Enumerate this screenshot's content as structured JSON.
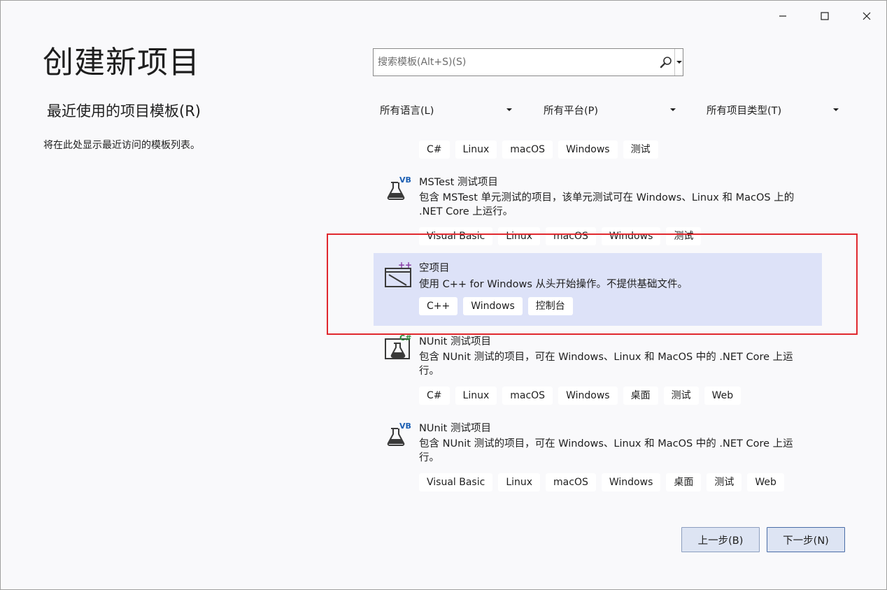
{
  "window": {
    "title": "创建新项目",
    "controls": {
      "minimize": "minimize-icon",
      "maximize": "maximize-icon",
      "close": "close-icon"
    }
  },
  "recent": {
    "heading": "最近使用的项目模板(R)",
    "empty_text": "将在此处显示最近访问的模板列表。"
  },
  "search": {
    "placeholder": "搜索模板(Alt+S)(S)",
    "value": ""
  },
  "filters": {
    "language": "所有语言(L)",
    "platform": "所有平台(P)",
    "project_type": "所有项目类型(T)"
  },
  "templates": [
    {
      "name": "",
      "description": "",
      "tags": [
        "C#",
        "Linux",
        "macOS",
        "Windows",
        "测试"
      ],
      "icon": "test-flask-icon"
    },
    {
      "name": "MSTest 测试项目",
      "description": "包含 MSTest 单元测试的项目，该单元测试可在 Windows、Linux 和 MacOS 上的 .NET Core 上运行。",
      "tags": [
        "Visual Basic",
        "Linux",
        "macOS",
        "Windows",
        "测试"
      ],
      "icon": "vb-test-flask-icon",
      "badge": "VB"
    },
    {
      "name": "空项目",
      "description": "使用 C++ for Windows 从头开始操作。不提供基础文件。",
      "tags": [
        "C++",
        "Windows",
        "控制台"
      ],
      "icon": "cpp-empty-project-icon",
      "badge": "++",
      "selected": true
    },
    {
      "name": "NUnit 测试项目",
      "description": "包含 NUnit 测试的项目，可在 Windows、Linux 和 MacOS 中的 .NET Core 上运行。",
      "tags": [
        "C#",
        "Linux",
        "macOS",
        "Windows",
        "桌面",
        "测试",
        "Web"
      ],
      "icon": "csharp-test-flask-icon",
      "badge": "C#"
    },
    {
      "name": "NUnit 测试项目",
      "description": "包含 NUnit 测试的项目，可在 Windows、Linux 和 MacOS 中的 .NET Core 上运行。",
      "tags": [
        "Visual Basic",
        "Linux",
        "macOS",
        "Windows",
        "桌面",
        "测试",
        "Web"
      ],
      "icon": "vb-test-flask-icon",
      "badge": "VB"
    }
  ],
  "buttons": {
    "back": "上一步(B)",
    "next": "下一步(N)"
  },
  "colors": {
    "background": "#f9f9fb",
    "selected_item": "#dde2f8",
    "highlight_border": "#e0282e",
    "vb_badge": "#1b5fb3",
    "cpp_badge": "#8a3fa8",
    "csharp_badge": "#2c8a3a"
  }
}
